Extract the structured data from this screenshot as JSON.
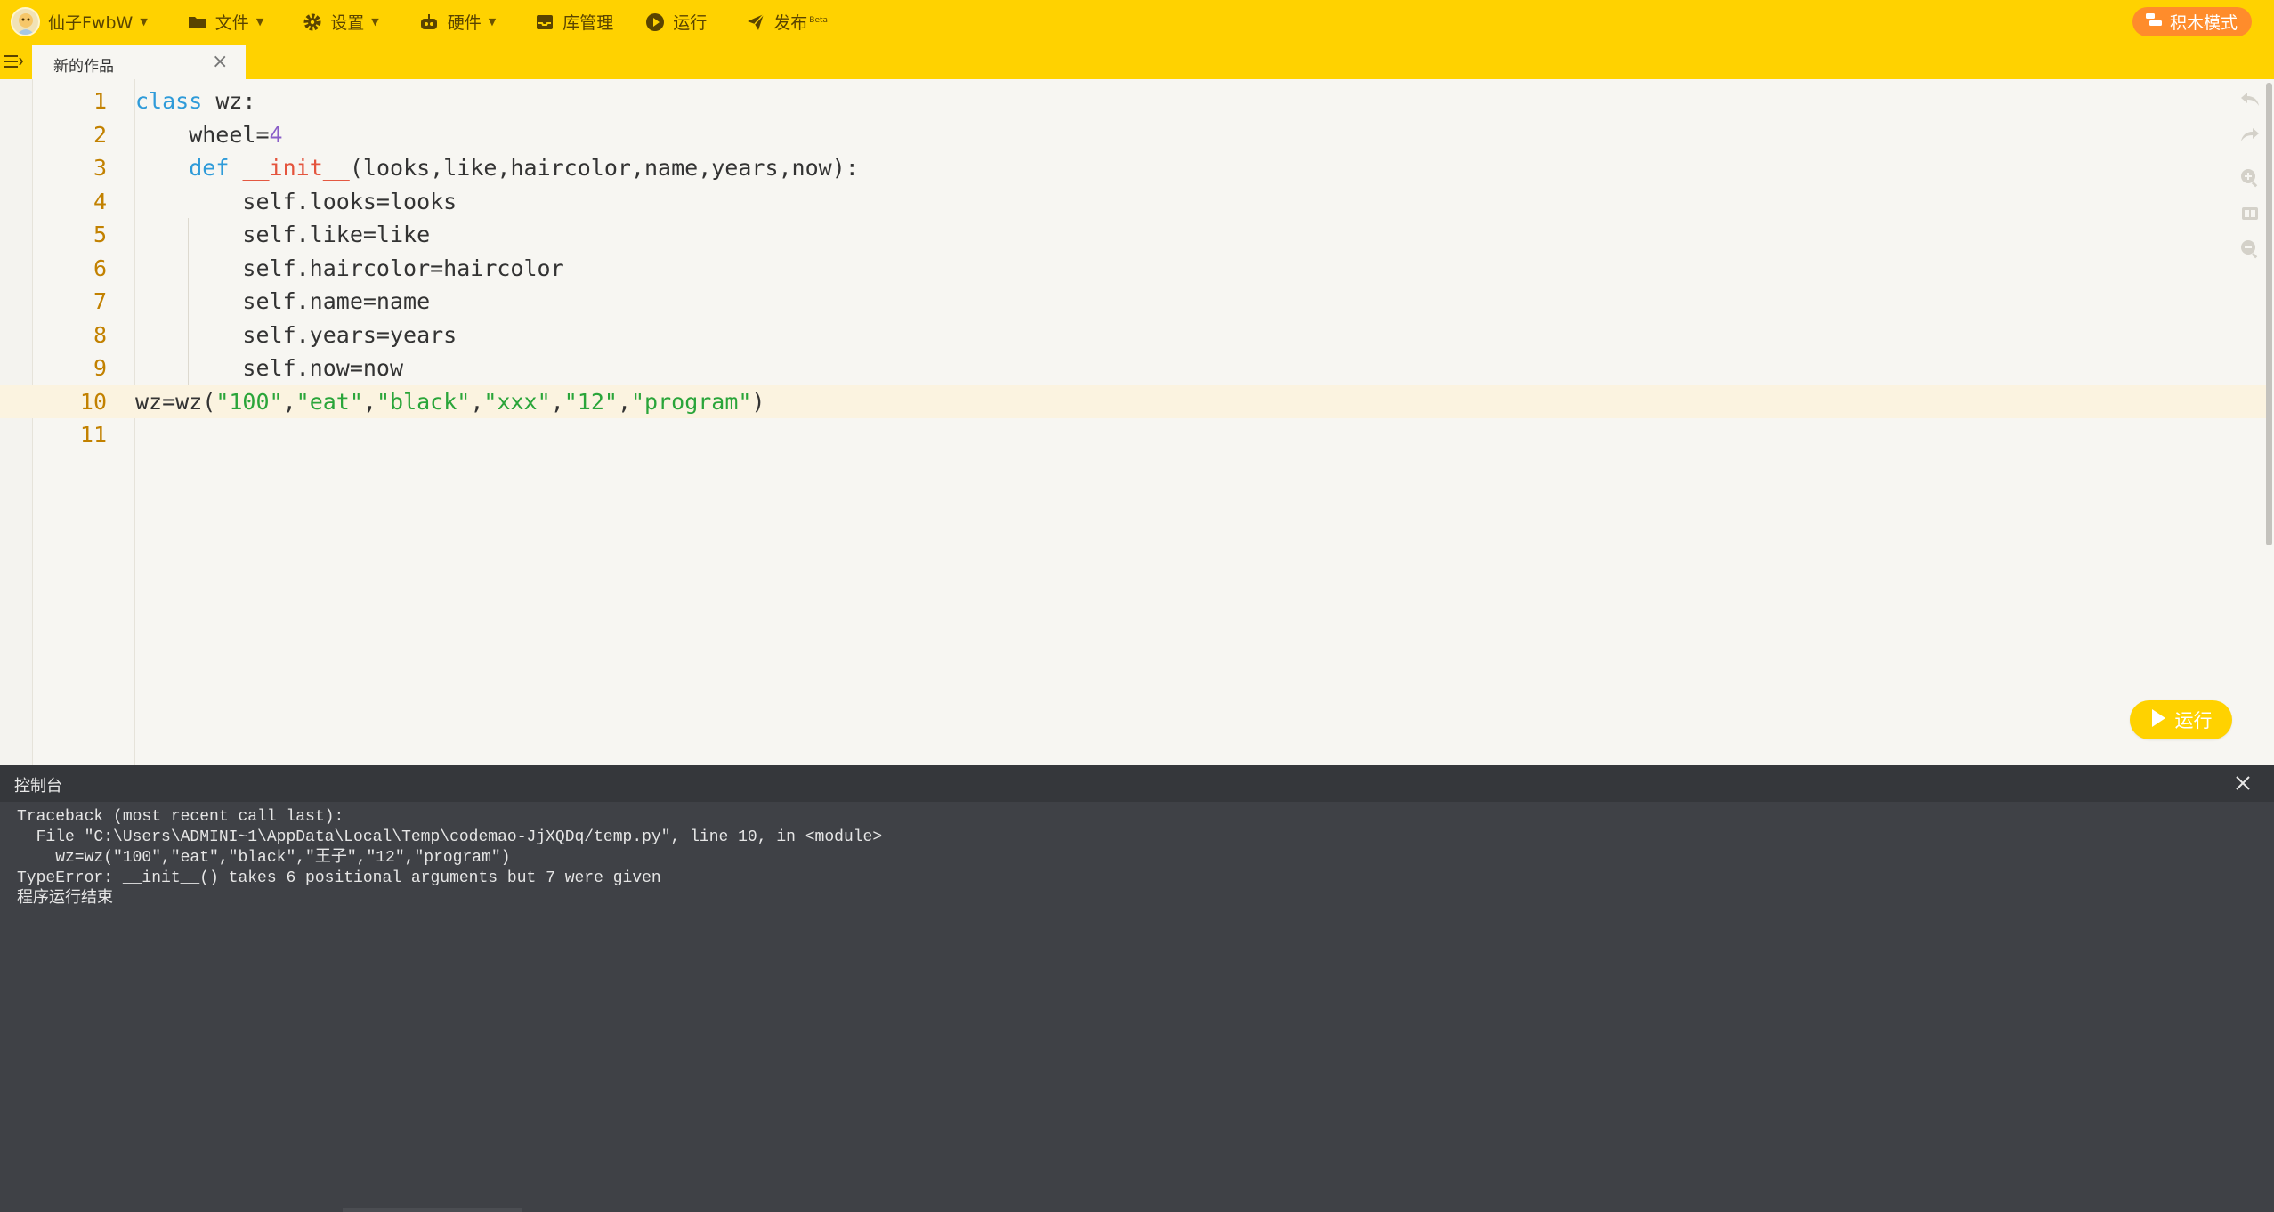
{
  "topbar": {
    "user_name": "仙子FwbW",
    "menu": [
      {
        "label": "文件",
        "icon": "folder-icon"
      },
      {
        "label": "设置",
        "icon": "gear-icon"
      },
      {
        "label": "硬件",
        "icon": "robot-icon"
      },
      {
        "label": "库管理",
        "icon": "inbox-icon"
      },
      {
        "label": "运行",
        "icon": "play-circle-icon"
      },
      {
        "label": "发布",
        "icon": "paper-plane-icon",
        "badge": "Beta"
      }
    ],
    "mode_button": "积木模式",
    "color": "#ffd200",
    "mode_button_color": "#ff8c2b"
  },
  "tab": {
    "title": "新的作品",
    "close": "×"
  },
  "editor": {
    "active_line": 10,
    "line_numbers": [
      "1",
      "2",
      "3",
      "4",
      "5",
      "6",
      "7",
      "8",
      "9",
      "10",
      "11"
    ],
    "lines": [
      "class wz:",
      "    wheel=4",
      "    def __init__(looks,like,haircolor,name,years,now):",
      "        self.looks=looks",
      "        self.like=like",
      "        self.haircolor=haircolor",
      "        self.name=name",
      "        self.years=years",
      "        self.now=now",
      "wz=wz(\"100\",\"eat\",\"black\",\"xxx\",\"12\",\"program\")",
      ""
    ],
    "run_button": "运行"
  },
  "console": {
    "title": "控制台",
    "output": [
      "Traceback (most recent call last):",
      "  File \"C:\\Users\\ADMINI~1\\AppData\\Local\\Temp\\codemao-JjXQDq/temp.py\", line 10, in <module>",
      "    wz=wz(\"100\",\"eat\",\"black\",\"王子\",\"12\",\"program\")",
      "TypeError: __init__() takes 6 positional arguments but 7 were given",
      "程序运行结束"
    ]
  }
}
